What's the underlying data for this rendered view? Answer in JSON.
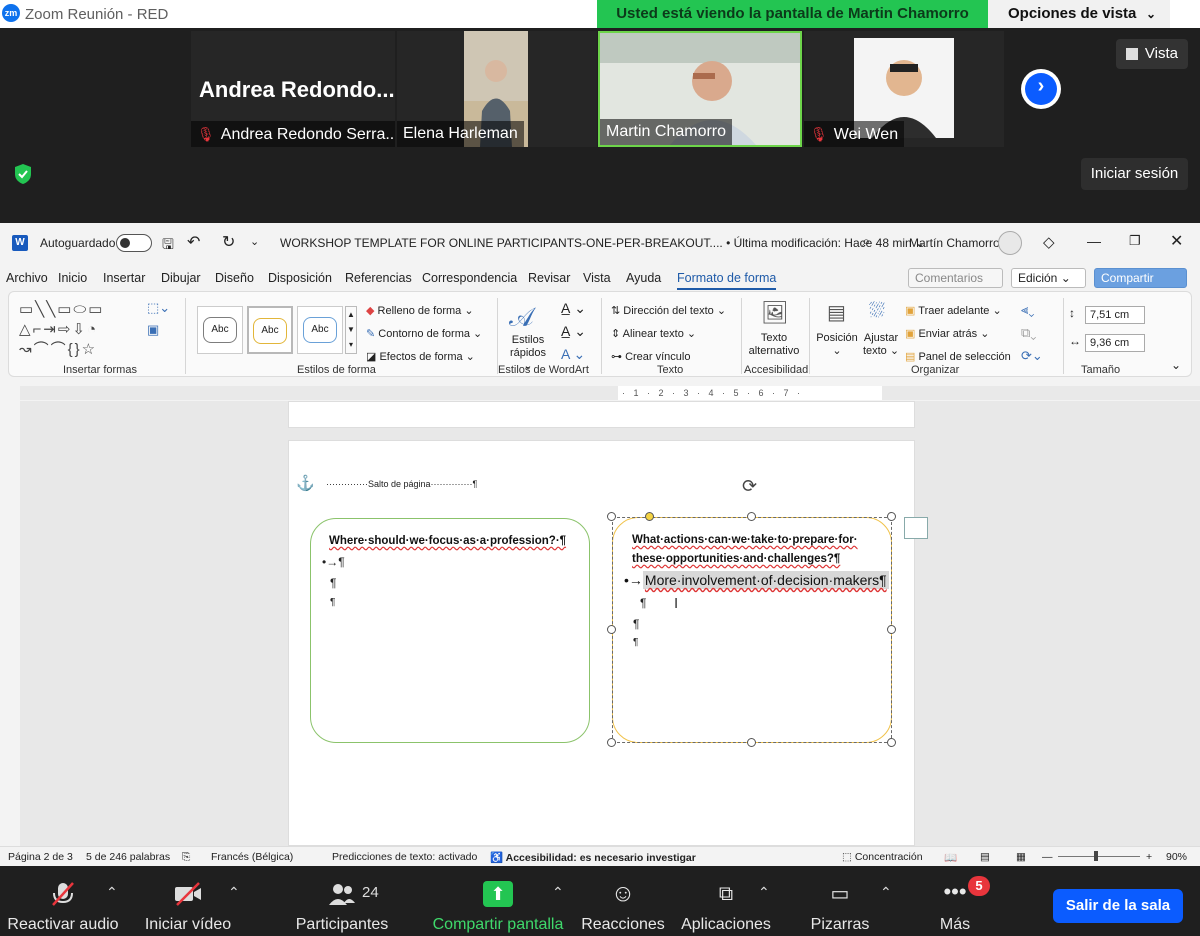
{
  "zoom": {
    "window_title": "Zoom Reunión - RED",
    "share_banner": "Usted está viendo la pantalla de Martin Chamorro",
    "view_options": "Opciones de vista",
    "view_button": "Vista",
    "signin_button": "Iniciar sesión",
    "participants_tiles": [
      {
        "big_name": "Andrea  Redondo...",
        "name": "Andrea Redondo Serra...",
        "muted": true
      },
      {
        "name": "Elena Harleman",
        "muted": false
      },
      {
        "name": "Martin Chamorro",
        "muted": false,
        "active_speaker": true
      },
      {
        "name": "Wei Wen",
        "muted": true
      }
    ],
    "toolbar": {
      "audio": "Reactivar audio",
      "video": "Iniciar vídeo",
      "participants": "Participantes",
      "participants_count": "24",
      "share": "Compartir pantalla",
      "reactions": "Reacciones",
      "apps": "Aplicaciones",
      "whiteboards": "Pizarras",
      "more": "Más",
      "more_badge": "5",
      "leave": "Salir de la sala"
    },
    "colors": {
      "share_green": "#23c552",
      "leave_blue": "#0b5cff",
      "badge_red": "#e8353c"
    }
  },
  "word": {
    "autosave_label": "Autoguardado",
    "doc_title": "WORKSHOP TEMPLATE FOR ONLINE PARTICIPANTS-ONE-PER-BREAKOUT.... • Última modificación: Hace 48 min ⌄",
    "user_name": "Martín Chamorro",
    "tabs": [
      "Archivo",
      "Inicio",
      "Insertar",
      "Dibujar",
      "Diseño",
      "Disposición",
      "Referencias",
      "Correspondencia",
      "Revisar",
      "Vista",
      "Ayuda",
      "Formato de forma"
    ],
    "comments_btn": "Comentarios",
    "edition_btn": "Edición ⌄",
    "share_btn": "Compartir",
    "ribbon": {
      "group_insert_shapes": "Insertar formas",
      "group_shape_styles": "Estilos de forma",
      "style_sample": "Abc",
      "fill": "Relleno de forma ⌄",
      "outline": "Contorno de forma ⌄",
      "effects": "Efectos de forma ⌄",
      "quick_styles": "Estilos rápidos ⌄",
      "group_wordart": "Estilos de WordArt",
      "text_direction": "Dirección del texto ⌄",
      "align_text": "Alinear texto ⌄",
      "create_link": "Crear vínculo",
      "group_text": "Texto",
      "alt_text": "Texto alternativo",
      "group_accessibility": "Accesibilidad",
      "position": "Posición ⌄",
      "wrap_text": "Ajustar texto ⌄",
      "bring_forward": "Traer adelante ⌄",
      "send_backward": "Enviar atrás ⌄",
      "selection_pane": "Panel de selección",
      "group_arrange": "Organizar",
      "height": "7,51 cm",
      "width": "9,36 cm",
      "group_size": "Tamaño"
    },
    "ruler_text": "· 1 · 2 · 3 · 4 · 5 · 6 · 7 ·",
    "page_break": "··············Salto de página··············¶",
    "left_question_a": "Where·should·we·focus·as·a·profession?·¶",
    "left_p1": "•→¶",
    "left_p2": "¶",
    "left_p3": "¶",
    "right_question_a": "What·actions·can·we·take·to·prepare·for·",
    "right_question_b": "these·opportunities·and·challenges?¶",
    "right_bullet": "•→",
    "right_answer": "More·involvement·of·decision·makers¶",
    "right_p1": "¶",
    "right_p2": "¶",
    "right_p3": "¶",
    "status": {
      "page": "Página 2 de 3",
      "words": "5 de 246 palabras",
      "language": "Francés (Bélgica)",
      "predictions": "Predicciones de texto: activado",
      "accessibility": "Accesibilidad: es necesario investigar",
      "focus": "Concentración",
      "zoom": "90%"
    }
  }
}
